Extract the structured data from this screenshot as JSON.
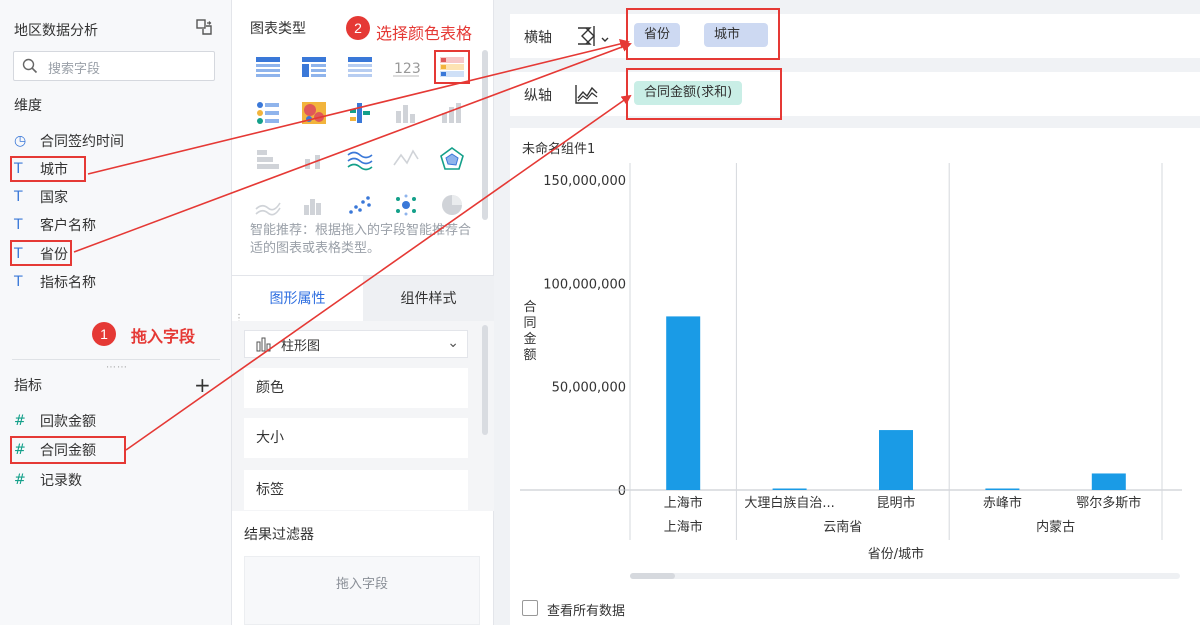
{
  "left_panel": {
    "title": "地区数据分析",
    "search_placeholder": "搜索字段",
    "dimension_label": "维度",
    "dimensions": [
      {
        "label": "合同签约时间",
        "icon": "clock-icon",
        "glyph": "◷"
      },
      {
        "label": "城市",
        "icon": "text-field-icon",
        "glyph": "T"
      },
      {
        "label": "国家",
        "icon": "text-field-icon",
        "glyph": "T"
      },
      {
        "label": "客户名称",
        "icon": "text-field-icon",
        "glyph": "T"
      },
      {
        "label": "省份",
        "icon": "text-field-icon",
        "glyph": "T"
      },
      {
        "label": "指标名称",
        "icon": "text-field-icon",
        "glyph": "T"
      }
    ],
    "metric_label": "指标",
    "metrics": [
      {
        "label": "回款金额",
        "icon": "hash-icon",
        "glyph": "#"
      },
      {
        "label": "合同金额",
        "icon": "hash-icon",
        "glyph": "#"
      },
      {
        "label": "记录数",
        "icon": "hash-icon",
        "glyph": "#"
      }
    ],
    "step1_number": "1",
    "step1_text": "拖入字段"
  },
  "middle_panel": {
    "chart_types_title": "图表类型",
    "step2_number": "2",
    "step2_text": "选择颜色表格",
    "smart_recommend": "智能推荐：根据拖入的字段智能推荐合适的图表或表格类型。",
    "tabs": [
      "图形属性",
      "组件样式"
    ],
    "chart_type_select": "柱形图",
    "properties": [
      "颜色",
      "大小",
      "标签"
    ],
    "filter_title": "结果过滤器",
    "filter_placeholder": "拖入字段"
  },
  "right_panel": {
    "x_axis_label": "横轴",
    "y_axis_label": "纵轴",
    "x_axis_fields": [
      "省份",
      "城市"
    ],
    "y_axis_fields": [
      "合同金额(求和)"
    ],
    "component_title": "未命名组件1",
    "view_all_data": "查看所有数据"
  },
  "colors": {
    "accent": "#2f6fe0",
    "bar": "#1a9be6",
    "highlight": "#e53935",
    "dimension_pill": "#cdd9f2",
    "metric_pill": "#c9eee6"
  },
  "chart_data": {
    "type": "bar",
    "xlabel": "省份/城市",
    "ylabel": "合同金额",
    "ylim": [
      0,
      150000000
    ],
    "yticks": [
      "150,000,000",
      "100,000,000",
      "50,000,000",
      "0"
    ],
    "ytick_values": [
      150000000,
      100000000,
      50000000,
      0
    ],
    "groups": [
      {
        "name": "上海市",
        "cities": [
          "上海市"
        ],
        "values": [
          84000000
        ]
      },
      {
        "name": "云南省",
        "cities": [
          "大理白族自治...",
          "昆明市"
        ],
        "values": [
          300000,
          29000000
        ]
      },
      {
        "name": "内蒙古",
        "cities": [
          "赤峰市",
          "鄂尔多斯市"
        ],
        "values": [
          300000,
          8000000
        ]
      }
    ]
  }
}
